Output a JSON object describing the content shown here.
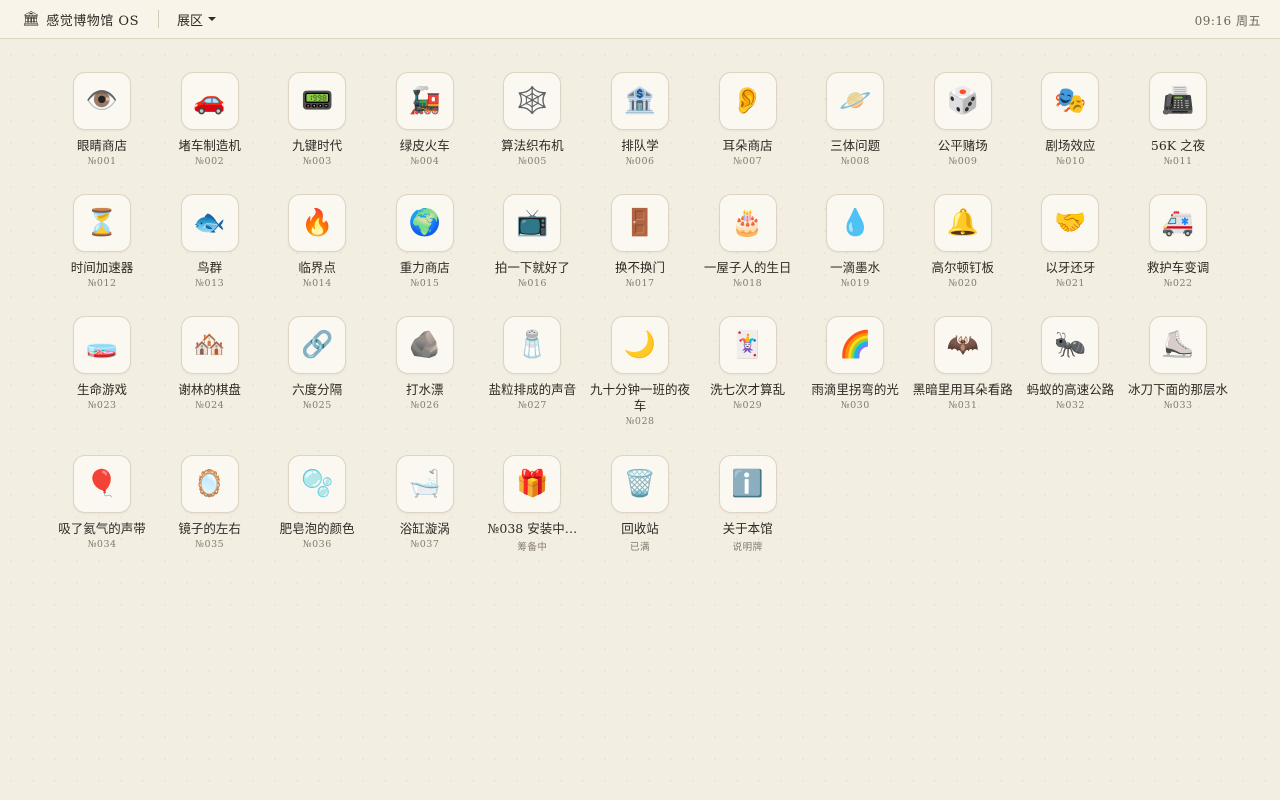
{
  "topbar": {
    "brand_icon": "museum-icon",
    "brand_glyph": "🏛",
    "brand": "感觉博物馆 OS",
    "menu_label": "展区",
    "clock": "09:16 周五"
  },
  "apps": [
    {
      "icon": "👁️",
      "icon_name": "eye-icon",
      "label": "眼睛商店",
      "num": "№001"
    },
    {
      "icon": "🚗",
      "icon_name": "car-icon",
      "label": "堵车制造机",
      "num": "№002"
    },
    {
      "icon": "📟",
      "icon_name": "pager-icon",
      "label": "九键时代",
      "num": "№003"
    },
    {
      "icon": "🚂",
      "icon_name": "locomotive-icon",
      "label": "绿皮火车",
      "num": "№004"
    },
    {
      "icon": "🕸️",
      "icon_name": "spiderweb-icon",
      "label": "算法织布机",
      "num": "№005"
    },
    {
      "icon": "🏦",
      "icon_name": "bank-icon",
      "label": "排队学",
      "num": "№006"
    },
    {
      "icon": "👂",
      "icon_name": "ear-icon",
      "label": "耳朵商店",
      "num": "№007"
    },
    {
      "icon": "🪐",
      "icon_name": "planet-icon",
      "label": "三体问题",
      "num": "№008"
    },
    {
      "icon": "🎲",
      "icon_name": "dice-icon",
      "label": "公平赌场",
      "num": "№009"
    },
    {
      "icon": "🎭",
      "icon_name": "theater-masks-icon",
      "label": "剧场效应",
      "num": "№010"
    },
    {
      "icon": "📠",
      "icon_name": "fax-icon",
      "label": "56K 之夜",
      "num": "№011"
    },
    {
      "icon": "⏳",
      "icon_name": "hourglass-icon",
      "label": "时间加速器",
      "num": "№012"
    },
    {
      "icon": "🐟",
      "icon_name": "fish-icon",
      "label": "鸟群",
      "num": "№013"
    },
    {
      "icon": "🔥",
      "icon_name": "fire-icon",
      "label": "临界点",
      "num": "№014"
    },
    {
      "icon": "🌍",
      "icon_name": "globe-icon",
      "label": "重力商店",
      "num": "№015"
    },
    {
      "icon": "📺",
      "icon_name": "tv-icon",
      "label": "拍一下就好了",
      "num": "№016"
    },
    {
      "icon": "🚪",
      "icon_name": "door-icon",
      "label": "换不换门",
      "num": "№017"
    },
    {
      "icon": "🎂",
      "icon_name": "birthday-cake-icon",
      "label": "一屋子人的生日",
      "num": "№018"
    },
    {
      "icon": "💧",
      "icon_name": "droplet-icon",
      "label": "一滴墨水",
      "num": "№019"
    },
    {
      "icon": "🔔",
      "icon_name": "bell-icon",
      "label": "高尔顿钉板",
      "num": "№020"
    },
    {
      "icon": "🤝",
      "icon_name": "handshake-icon",
      "label": "以牙还牙",
      "num": "№021"
    },
    {
      "icon": "🚑",
      "icon_name": "ambulance-icon",
      "label": "救护车变调",
      "num": "№022"
    },
    {
      "icon": "🧫",
      "icon_name": "petri-dish-icon",
      "label": "生命游戏",
      "num": "№023"
    },
    {
      "icon": "🏘️",
      "icon_name": "houses-icon",
      "label": "谢林的棋盘",
      "num": "№024"
    },
    {
      "icon": "🔗",
      "icon_name": "link-icon",
      "label": "六度分隔",
      "num": "№025"
    },
    {
      "icon": "🪨",
      "icon_name": "rock-icon",
      "label": "打水漂",
      "num": "№026"
    },
    {
      "icon": "🧂",
      "icon_name": "salt-icon",
      "label": "盐粒排成的声音",
      "num": "№027"
    },
    {
      "icon": "🌙",
      "icon_name": "moon-icon",
      "label": "九十分钟一班的夜车",
      "num": "№028"
    },
    {
      "icon": "🃏",
      "icon_name": "joker-card-icon",
      "label": "洗七次才算乱",
      "num": "№029"
    },
    {
      "icon": "🌈",
      "icon_name": "rainbow-icon",
      "label": "雨滴里拐弯的光",
      "num": "№030"
    },
    {
      "icon": "🦇",
      "icon_name": "bat-icon",
      "label": "黑暗里用耳朵看路",
      "num": "№031"
    },
    {
      "icon": "🐜",
      "icon_name": "ant-icon",
      "label": "蚂蚁的高速公路",
      "num": "№032"
    },
    {
      "icon": "⛸️",
      "icon_name": "ice-skate-icon",
      "label": "冰刀下面的那层水",
      "num": "№033"
    },
    {
      "icon": "🎈",
      "icon_name": "balloon-icon",
      "label": "吸了氦气的声带",
      "num": "№034"
    },
    {
      "icon": "🪞",
      "icon_name": "mirror-icon",
      "label": "镜子的左右",
      "num": "№035"
    },
    {
      "icon": "🫧",
      "icon_name": "bubbles-icon",
      "label": "肥皂泡的颜色",
      "num": "№036"
    },
    {
      "icon": "🛁",
      "icon_name": "bathtub-icon",
      "label": "浴缸漩涡",
      "num": "№037"
    },
    {
      "icon": "🎁",
      "icon_name": "gift-icon",
      "label": "№038 安装中…",
      "num": "筹备中"
    },
    {
      "icon": "🗑️",
      "icon_name": "trash-icon",
      "label": "回收站",
      "num": "已满"
    },
    {
      "icon": "ℹ️",
      "icon_name": "info-icon",
      "label": "关于本馆",
      "num": "说明牌"
    }
  ]
}
